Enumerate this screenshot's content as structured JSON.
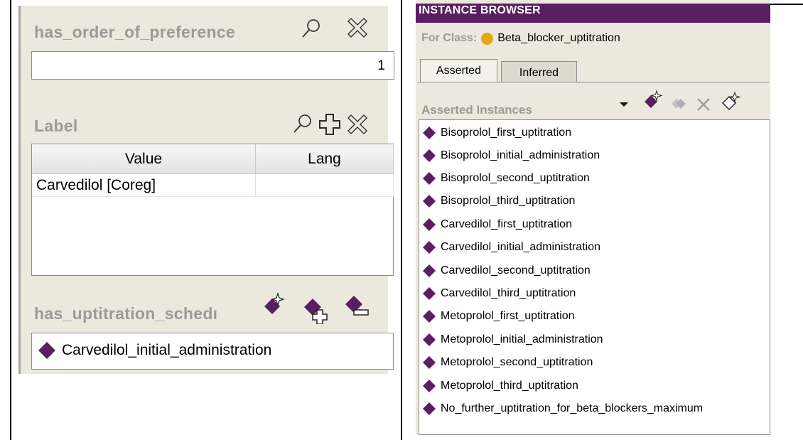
{
  "left": {
    "preference": {
      "title": "has_order_of_preference",
      "value": "1",
      "icons": [
        "search-icon",
        "delete-icon"
      ]
    },
    "label": {
      "title": "Label",
      "columns": [
        "Value",
        "Lang"
      ],
      "rows": [
        {
          "value": "Carvedilol [Coreg]",
          "lang": ""
        }
      ],
      "icons": [
        "search-icon",
        "add-icon",
        "delete-icon"
      ]
    },
    "schedule": {
      "title": "has_uptitration_schedı",
      "items": [
        "Carvedilol_initial_administration"
      ],
      "icons": [
        "create-instance-icon",
        "add-instance-icon",
        "remove-instance-icon"
      ]
    }
  },
  "right": {
    "header": "INSTANCE BROWSER",
    "for_class_label": "For Class:",
    "class_name": "Beta_blocker_uptitration",
    "tabs": [
      "Asserted",
      "Inferred"
    ],
    "active_tab": "Asserted",
    "list_title": "Asserted Instances",
    "toolbar_icons": [
      "dropdown-arrow-icon",
      "create-instance-icon",
      "duplicate-instance-icon",
      "delete-icon",
      "new-instance-icon"
    ],
    "instances": [
      "Bisoprolol_first_uptitration",
      "Bisoprolol_initial_administration",
      "Bisoprolol_second_uptitration",
      "Bisoprolol_third_uptitration",
      "Carvedilol_first_uptitration",
      "Carvedilol_initial_administration",
      "Carvedilol_second_uptitration",
      "Carvedilol_third_uptitration",
      "Metoprolol_first_uptitration",
      "Metoprolol_initial_administration",
      "Metoprolol_second_uptitration",
      "Metoprolol_third_uptitration",
      "No_further_uptitration_for_beta_blockers_maximum"
    ]
  },
  "colors": {
    "instance_diamond": "#5a1f61",
    "header_bg": "#5a1f61",
    "class_dot": "#e8a413",
    "panel_bg": "#ebe9dd"
  }
}
